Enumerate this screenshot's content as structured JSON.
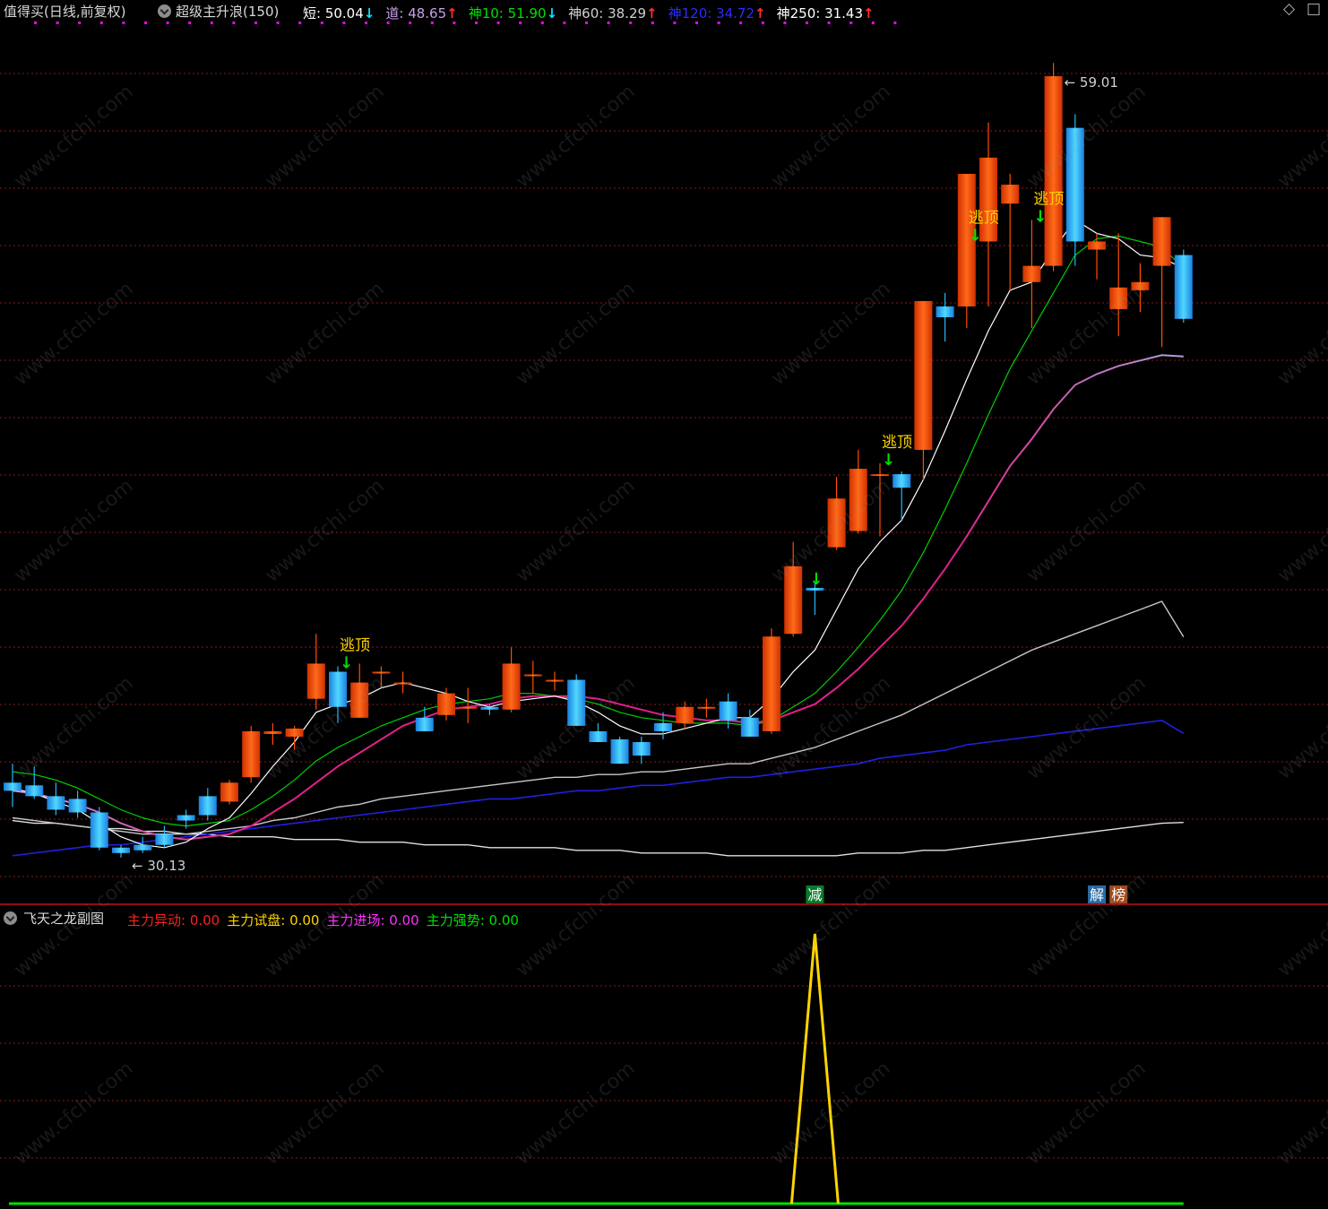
{
  "header": {
    "stock": "值得买(日线,前复权)",
    "indicator": "超级主升浪(150)",
    "items": [
      {
        "label": "短: ",
        "value": "50.04",
        "arrow": "↓",
        "color": "#ffffff",
        "arrowColor": "#00e5ff"
      },
      {
        "label": "道: ",
        "value": "48.65",
        "arrow": "↑",
        "color": "#c8a0e8",
        "arrowColor": "#ff3030"
      },
      {
        "label": "神10: ",
        "value": "51.90",
        "arrow": "↓",
        "color": "#00e000",
        "arrowColor": "#00e5ff"
      },
      {
        "label": "神60: ",
        "value": "38.29",
        "arrow": "↑",
        "color": "#d0d0d0",
        "arrowColor": "#ff3030"
      },
      {
        "label": "神120: ",
        "value": "34.72",
        "arrow": "↑",
        "color": "#2b2bff",
        "arrowColor": "#ff3030"
      },
      {
        "label": "神250: ",
        "value": "31.43",
        "arrow": "↑",
        "color": "#ffffff",
        "arrowColor": "#ff3030"
      }
    ]
  },
  "main": {
    "high_label": "59.01",
    "low_label": "30.13",
    "signal_text": "逃顶",
    "badges": {
      "reduce": "减",
      "unlock": "解",
      "rank": "榜"
    }
  },
  "sub": {
    "title": "飞天之龙副图",
    "items": [
      {
        "label": "主力异动: ",
        "value": "0.00",
        "color": "#ff2020"
      },
      {
        "label": "主力试盘: ",
        "value": "0.00",
        "color": "#ffd400"
      },
      {
        "label": "主力进场: ",
        "value": "0.00",
        "color": "#ff30ff"
      },
      {
        "label": "主力强势: ",
        "value": "0.00",
        "color": "#00e000"
      }
    ]
  },
  "watermark": "www.cfchi.com",
  "colors": {
    "up": "#ff4d00",
    "down": "#27b6ff",
    "grid": "#8b1a1a",
    "dot": "#ff00ff"
  },
  "chart_data": {
    "type": "candlestick",
    "price_range": [
      29.2,
      60.5
    ],
    "candles": [
      {
        "o": 32.9,
        "h": 33.6,
        "l": 32.0,
        "c": 32.6
      },
      {
        "o": 32.8,
        "h": 33.5,
        "l": 32.3,
        "c": 32.4
      },
      {
        "o": 32.4,
        "h": 32.9,
        "l": 31.7,
        "c": 31.9
      },
      {
        "o": 32.3,
        "h": 32.6,
        "l": 31.6,
        "c": 31.8
      },
      {
        "o": 31.8,
        "h": 32.0,
        "l": 30.4,
        "c": 30.5
      },
      {
        "o": 30.5,
        "h": 30.6,
        "l": 30.13,
        "c": 30.3
      },
      {
        "o": 30.6,
        "h": 30.9,
        "l": 30.3,
        "c": 30.4
      },
      {
        "o": 31.0,
        "h": 31.3,
        "l": 30.5,
        "c": 30.6
      },
      {
        "o": 31.7,
        "h": 31.9,
        "l": 31.2,
        "c": 31.5
      },
      {
        "o": 32.4,
        "h": 32.7,
        "l": 31.5,
        "c": 31.7
      },
      {
        "o": 32.2,
        "h": 33.0,
        "l": 32.1,
        "c": 32.9
      },
      {
        "o": 33.1,
        "h": 35.0,
        "l": 32.9,
        "c": 34.8
      },
      {
        "o": 34.7,
        "h": 35.1,
        "l": 34.3,
        "c": 34.8
      },
      {
        "o": 34.6,
        "h": 35.0,
        "l": 34.1,
        "c": 34.9
      },
      {
        "o": 36.0,
        "h": 38.4,
        "l": 35.6,
        "c": 37.3
      },
      {
        "o": 37.0,
        "h": 37.2,
        "l": 35.1,
        "c": 35.7
      },
      {
        "o": 35.3,
        "h": 37.3,
        "l": 35.3,
        "c": 36.6
      },
      {
        "o": 37.0,
        "h": 37.2,
        "l": 36.4,
        "c": 37.0
      },
      {
        "o": 36.6,
        "h": 37.0,
        "l": 36.2,
        "c": 36.6
      },
      {
        "o": 35.3,
        "h": 35.7,
        "l": 34.8,
        "c": 34.8
      },
      {
        "o": 35.4,
        "h": 36.4,
        "l": 35.2,
        "c": 36.2
      },
      {
        "o": 35.7,
        "h": 36.4,
        "l": 35.1,
        "c": 35.7
      },
      {
        "o": 35.7,
        "h": 35.8,
        "l": 35.4,
        "c": 35.6
      },
      {
        "o": 35.6,
        "h": 37.9,
        "l": 35.5,
        "c": 37.3
      },
      {
        "o": 36.9,
        "h": 37.4,
        "l": 36.2,
        "c": 36.9
      },
      {
        "o": 36.7,
        "h": 37.0,
        "l": 36.3,
        "c": 36.7
      },
      {
        "o": 36.7,
        "h": 36.9,
        "l": 35.0,
        "c": 35.0
      },
      {
        "o": 34.8,
        "h": 35.1,
        "l": 34.4,
        "c": 34.4
      },
      {
        "o": 34.5,
        "h": 34.6,
        "l": 33.6,
        "c": 33.6
      },
      {
        "o": 34.4,
        "h": 34.6,
        "l": 33.6,
        "c": 33.9
      },
      {
        "o": 35.1,
        "h": 35.5,
        "l": 34.5,
        "c": 34.8
      },
      {
        "o": 35.1,
        "h": 35.9,
        "l": 34.9,
        "c": 35.7
      },
      {
        "o": 35.7,
        "h": 36.0,
        "l": 35.3,
        "c": 35.7
      },
      {
        "o": 35.9,
        "h": 36.2,
        "l": 34.9,
        "c": 35.2
      },
      {
        "o": 35.3,
        "h": 35.6,
        "l": 34.6,
        "c": 34.6
      },
      {
        "o": 34.8,
        "h": 38.6,
        "l": 34.7,
        "c": 38.3
      },
      {
        "o": 38.4,
        "h": 41.8,
        "l": 38.3,
        "c": 40.9
      },
      {
        "o": 40.1,
        "h": 40.3,
        "l": 39.1,
        "c": 40.0
      },
      {
        "o": 41.6,
        "h": 44.2,
        "l": 41.5,
        "c": 43.4
      },
      {
        "o": 42.2,
        "h": 45.2,
        "l": 42.1,
        "c": 44.5
      },
      {
        "o": 44.3,
        "h": 44.7,
        "l": 42.0,
        "c": 44.3
      },
      {
        "o": 44.3,
        "h": 44.4,
        "l": 42.6,
        "c": 43.8
      },
      {
        "o": 45.2,
        "h": 49.8,
        "l": 44.1,
        "c": 50.7
      },
      {
        "o": 50.5,
        "h": 51.0,
        "l": 49.2,
        "c": 50.1
      },
      {
        "o": 50.5,
        "h": 53.0,
        "l": 49.7,
        "c": 55.4
      },
      {
        "o": 52.9,
        "h": 57.3,
        "l": 50.5,
        "c": 56.0
      },
      {
        "o": 54.3,
        "h": 55.4,
        "l": 51.1,
        "c": 55.0
      },
      {
        "o": 51.4,
        "h": 53.7,
        "l": 49.7,
        "c": 52.0
      },
      {
        "o": 52.0,
        "h": 59.5,
        "l": 51.8,
        "c": 59.01
      },
      {
        "o": 57.1,
        "h": 57.6,
        "l": 52.0,
        "c": 52.9
      },
      {
        "o": 52.6,
        "h": 53.2,
        "l": 51.5,
        "c": 52.9
      },
      {
        "o": 50.4,
        "h": 53.2,
        "l": 49.4,
        "c": 51.2
      },
      {
        "o": 51.1,
        "h": 52.1,
        "l": 50.3,
        "c": 51.4
      },
      {
        "o": 52.0,
        "h": 53.7,
        "l": 49.0,
        "c": 53.8
      },
      {
        "o": 52.4,
        "h": 52.6,
        "l": 49.9,
        "c": 50.04
      }
    ],
    "ma": {
      "短": [
        32.7,
        32.5,
        32.2,
        31.9,
        31.4,
        30.9,
        30.6,
        30.5,
        30.7,
        31.2,
        31.6,
        32.5,
        33.5,
        34.4,
        35.5,
        35.8,
        36.0,
        36.4,
        36.6,
        36.4,
        36.2,
        35.9,
        35.7,
        35.9,
        36.0,
        36.1,
        35.9,
        35.5,
        35.0,
        34.7,
        34.7,
        34.9,
        35.1,
        35.3,
        35.3,
        36.0,
        37.0,
        37.8,
        39.3,
        40.8,
        41.8,
        42.6,
        44.1,
        45.9,
        47.8,
        49.6,
        51.1,
        51.4,
        52.6,
        53.7,
        53.2,
        53.0,
        52.4,
        52.3,
        51.9
      ],
      "道": [
        32.6,
        32.5,
        32.3,
        32.1,
        31.8,
        31.4,
        31.1,
        30.9,
        30.8,
        30.9,
        31.0,
        31.3,
        31.8,
        32.3,
        32.9,
        33.5,
        34.0,
        34.5,
        35.0,
        35.3,
        35.6,
        35.7,
        35.8,
        36.0,
        36.1,
        36.1,
        36.1,
        36.0,
        35.8,
        35.6,
        35.4,
        35.3,
        35.2,
        35.2,
        35.1,
        35.2,
        35.5,
        35.8,
        36.4,
        37.1,
        37.9,
        38.7,
        39.7,
        40.8,
        42.0,
        43.3,
        44.6,
        45.6,
        46.7,
        47.6,
        48.0,
        48.3,
        48.5,
        48.7,
        48.65
      ],
      "神10": [
        33.3,
        33.2,
        33.0,
        32.7,
        32.3,
        31.9,
        31.6,
        31.4,
        31.3,
        31.4,
        31.5,
        31.9,
        32.4,
        33.0,
        33.7,
        34.2,
        34.6,
        35.0,
        35.3,
        35.6,
        35.8,
        35.9,
        36.0,
        36.2,
        36.2,
        36.1,
        36.0,
        35.8,
        35.5,
        35.3,
        35.2,
        35.1,
        35.1,
        35.1,
        35.0,
        35.2,
        35.7,
        36.2,
        37.0,
        37.9,
        38.9,
        40.0,
        41.4,
        43.0,
        44.7,
        46.5,
        48.2,
        49.6,
        51.0,
        52.4,
        53.0,
        53.1,
        52.9,
        52.7,
        51.9
      ],
      "神60": [
        31.6,
        31.5,
        31.4,
        31.3,
        31.2,
        31.1,
        31.0,
        31.0,
        31.0,
        31.1,
        31.2,
        31.3,
        31.5,
        31.6,
        31.8,
        32.0,
        32.1,
        32.3,
        32.4,
        32.5,
        32.6,
        32.7,
        32.8,
        32.9,
        33.0,
        33.1,
        33.1,
        33.2,
        33.2,
        33.3,
        33.3,
        33.4,
        33.5,
        33.6,
        33.6,
        33.8,
        34.0,
        34.2,
        34.5,
        34.8,
        35.1,
        35.4,
        35.8,
        36.2,
        36.6,
        37.0,
        37.4,
        37.8,
        38.1,
        38.4,
        38.7,
        39.0,
        39.3,
        39.6,
        38.29
      ],
      "神120": [
        30.2,
        30.3,
        30.4,
        30.5,
        30.6,
        30.6,
        30.7,
        30.8,
        30.9,
        31.0,
        31.1,
        31.2,
        31.3,
        31.4,
        31.5,
        31.6,
        31.7,
        31.8,
        31.9,
        32.0,
        32.1,
        32.2,
        32.3,
        32.3,
        32.4,
        32.5,
        32.6,
        32.6,
        32.7,
        32.8,
        32.8,
        32.9,
        33.0,
        33.1,
        33.1,
        33.2,
        33.3,
        33.4,
        33.5,
        33.6,
        33.8,
        33.9,
        34.0,
        34.1,
        34.3,
        34.4,
        34.5,
        34.6,
        34.7,
        34.8,
        34.9,
        35.0,
        35.1,
        35.2,
        34.72
      ],
      "神250": [
        31.5,
        31.4,
        31.4,
        31.3,
        31.2,
        31.2,
        31.1,
        31.1,
        31.0,
        31.0,
        30.9,
        30.9,
        30.9,
        30.8,
        30.8,
        30.8,
        30.7,
        30.7,
        30.7,
        30.6,
        30.6,
        30.6,
        30.5,
        30.5,
        30.5,
        30.5,
        30.4,
        30.4,
        30.4,
        30.3,
        30.3,
        30.3,
        30.3,
        30.2,
        30.2,
        30.2,
        30.2,
        30.2,
        30.2,
        30.3,
        30.3,
        30.3,
        30.4,
        30.4,
        30.5,
        30.6,
        30.7,
        30.8,
        30.9,
        31.0,
        31.1,
        31.2,
        31.3,
        31.4,
        31.43
      ]
    },
    "signals": [
      15,
      40,
      44,
      47
    ],
    "green_arrow_only": [
      37
    ],
    "sub_series": {
      "name": "主力试盘",
      "values": [
        0,
        0,
        0,
        0,
        0,
        0,
        0,
        0,
        0,
        0,
        0,
        0,
        0,
        0,
        0,
        0,
        0,
        0,
        0,
        0,
        0,
        0,
        0,
        0,
        0,
        0,
        0,
        0,
        0,
        0,
        0,
        0,
        0,
        0,
        0,
        0,
        0,
        1,
        0,
        0,
        0,
        0,
        0,
        0,
        0,
        0,
        0,
        0,
        0,
        0,
        0,
        0,
        0,
        0,
        0
      ]
    }
  }
}
